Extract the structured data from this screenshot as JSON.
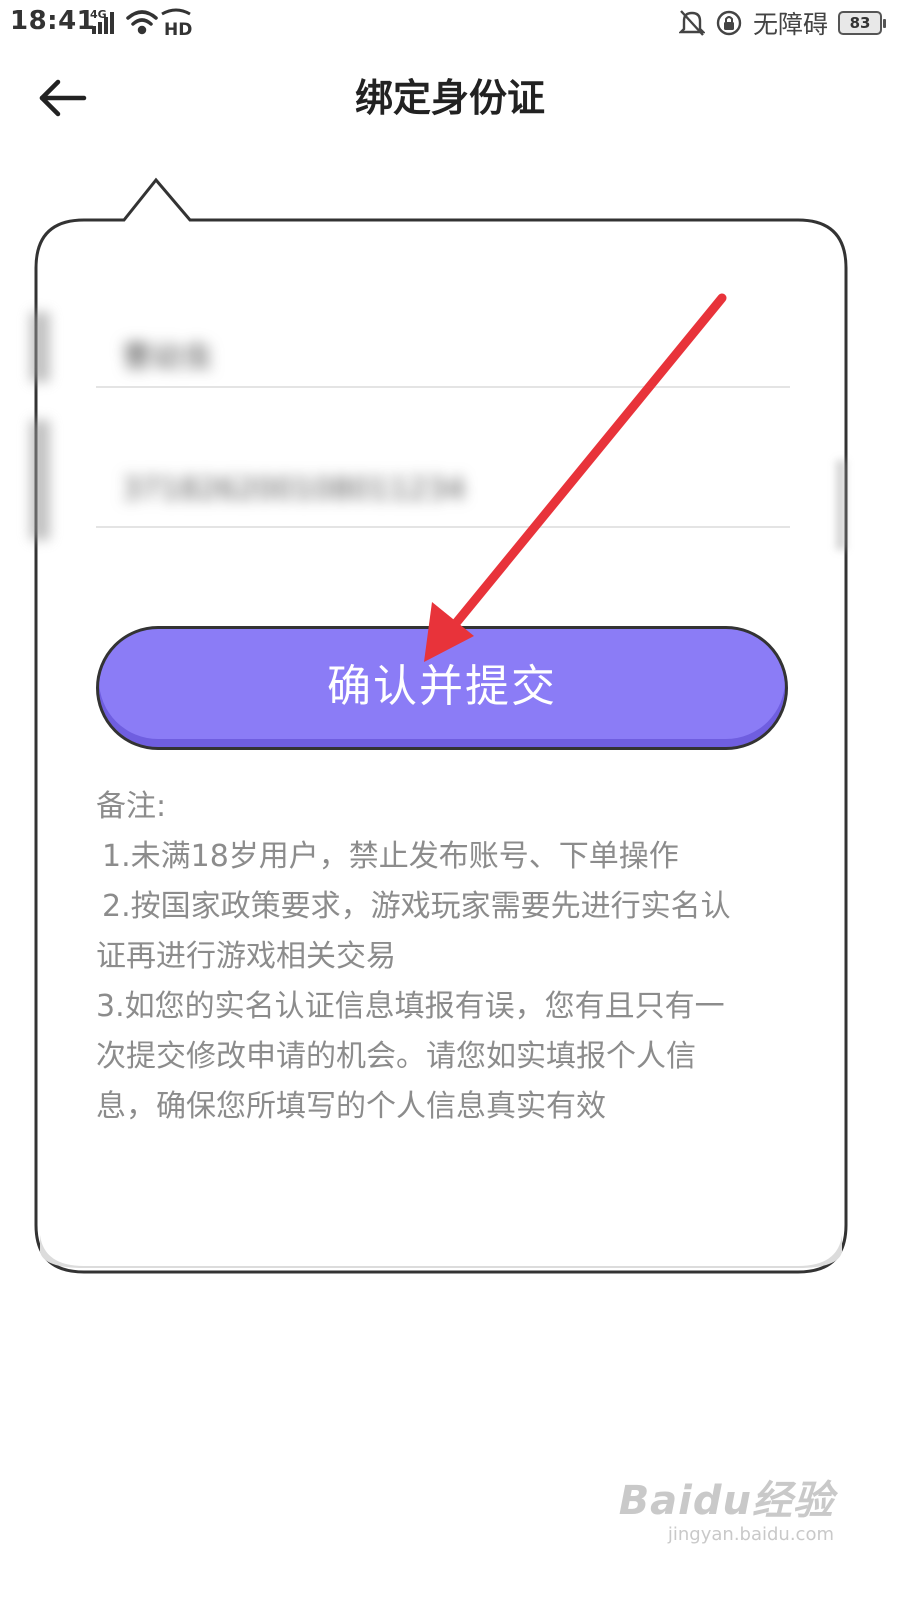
{
  "status_bar": {
    "time": "18:41",
    "network": "4G",
    "hd": "HD",
    "accessibility": "无障碍",
    "battery": "83"
  },
  "header": {
    "title": "绑定身份证"
  },
  "form": {
    "name_value": "曹幼虫",
    "id_value": "371826200108011234"
  },
  "submit_label": "确认并提交",
  "notes": {
    "title": "备注:",
    "line1": "1.未满18岁用户，禁止发布账号、下单操作",
    "line2a": "2.按国家政策要求，游戏玩家需要先进行实名认",
    "line2b": "证再进行游戏相关交易",
    "line3a": "3.如您的实名认证信息填报有误，您有且只有一",
    "line3b": "次提交修改申请的机会。请您如实填报个人信",
    "line3c": "息，确保您所填写的个人信息真实有效"
  },
  "watermark": {
    "brand": "Baidu经验",
    "url": "jingyan.baidu.com"
  },
  "colors": {
    "button": "#8b7cf6",
    "arrow": "#e8333a",
    "note_text": "#8c8c8c"
  }
}
